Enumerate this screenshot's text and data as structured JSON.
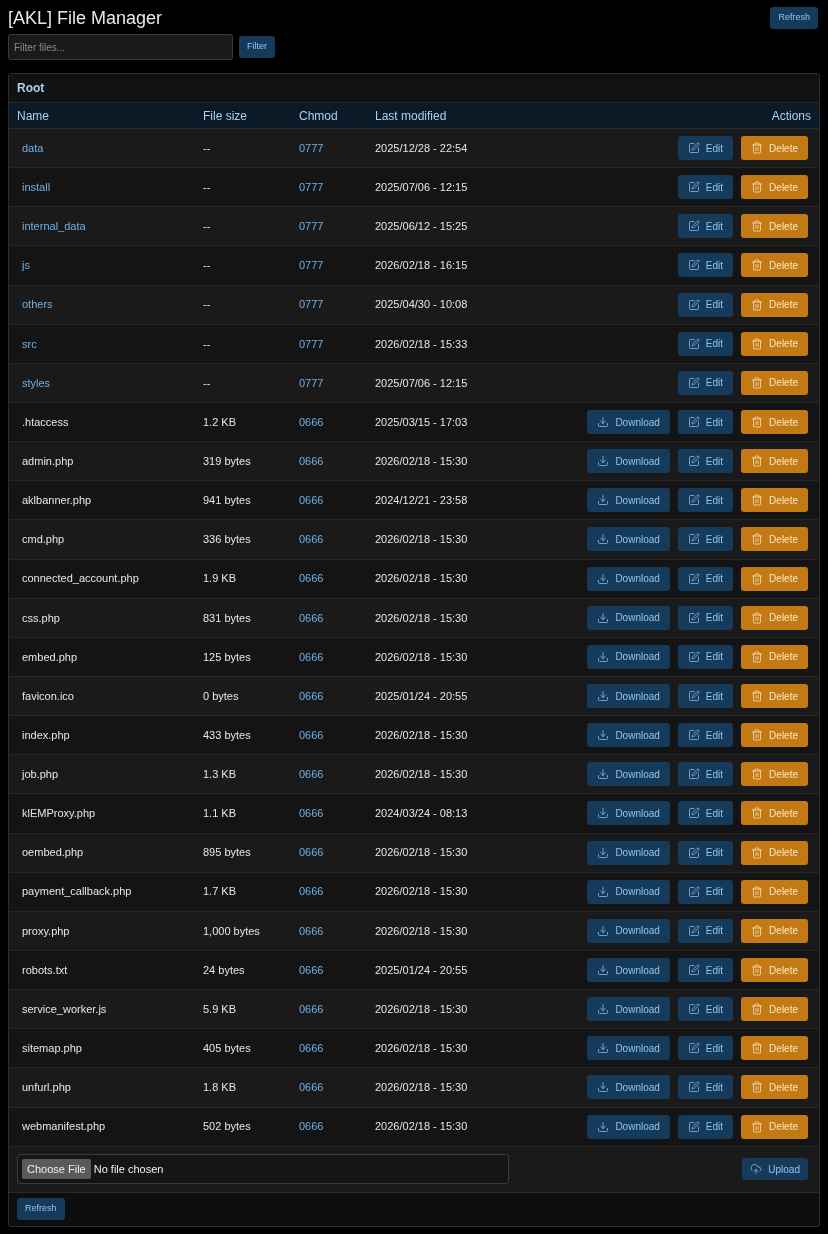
{
  "header": {
    "title": "[AKL] File Manager",
    "refresh_button": "Refresh"
  },
  "filter": {
    "placeholder": "Filter files...",
    "button": "Filter"
  },
  "panel": {
    "title": "Root",
    "columns": [
      "Name",
      "File size",
      "Chmod",
      "Last modified",
      "Actions"
    ],
    "rows": [
      {
        "kind": "folder",
        "name": "data",
        "size": "--",
        "chmod": "0777",
        "modified": "2025/12/28 - 22:54",
        "actions": [
          {
            "kind": "edit",
            "label": "Edit"
          },
          {
            "kind": "delete",
            "label": "Delete"
          }
        ]
      },
      {
        "kind": "folder",
        "name": "install",
        "size": "--",
        "chmod": "0777",
        "modified": "2025/07/06 - 12:15",
        "actions": [
          {
            "kind": "edit",
            "label": "Edit"
          },
          {
            "kind": "delete",
            "label": "Delete"
          }
        ]
      },
      {
        "kind": "folder",
        "name": "internal_data",
        "size": "--",
        "chmod": "0777",
        "modified": "2025/06/12 - 15:25",
        "actions": [
          {
            "kind": "edit",
            "label": "Edit"
          },
          {
            "kind": "delete",
            "label": "Delete"
          }
        ]
      },
      {
        "kind": "folder",
        "name": "js",
        "size": "--",
        "chmod": "0777",
        "modified": "2026/02/18 - 16:15",
        "actions": [
          {
            "kind": "edit",
            "label": "Edit"
          },
          {
            "kind": "delete",
            "label": "Delete"
          }
        ]
      },
      {
        "kind": "folder",
        "name": "others",
        "size": "--",
        "chmod": "0777",
        "modified": "2025/04/30 - 10:08",
        "actions": [
          {
            "kind": "edit",
            "label": "Edit"
          },
          {
            "kind": "delete",
            "label": "Delete"
          }
        ]
      },
      {
        "kind": "folder",
        "name": "src",
        "size": "--",
        "chmod": "0777",
        "modified": "2026/02/18 - 15:33",
        "actions": [
          {
            "kind": "edit",
            "label": "Edit"
          },
          {
            "kind": "delete",
            "label": "Delete"
          }
        ]
      },
      {
        "kind": "folder",
        "name": "styles",
        "size": "--",
        "chmod": "0777",
        "modified": "2025/07/06 - 12:15",
        "actions": [
          {
            "kind": "edit",
            "label": "Edit"
          },
          {
            "kind": "delete",
            "label": "Delete"
          }
        ]
      },
      {
        "kind": "file",
        "name": ".htaccess",
        "size": "1.2 KB",
        "chmod": "0666",
        "modified": "2025/03/15 - 17:03",
        "actions": [
          {
            "kind": "download",
            "label": "Download"
          },
          {
            "kind": "edit",
            "label": "Edit"
          },
          {
            "kind": "delete",
            "label": "Delete"
          }
        ]
      },
      {
        "kind": "file",
        "name": "admin.php",
        "size": "319 bytes",
        "chmod": "0666",
        "modified": "2026/02/18 - 15:30",
        "actions": [
          {
            "kind": "download",
            "label": "Download"
          },
          {
            "kind": "edit",
            "label": "Edit"
          },
          {
            "kind": "delete",
            "label": "Delete"
          }
        ]
      },
      {
        "kind": "file",
        "name": "aklbanner.php",
        "size": "941 bytes",
        "chmod": "0666",
        "modified": "2024/12/21 - 23:58",
        "actions": [
          {
            "kind": "download",
            "label": "Download"
          },
          {
            "kind": "edit",
            "label": "Edit"
          },
          {
            "kind": "delete",
            "label": "Delete"
          }
        ]
      },
      {
        "kind": "file",
        "name": "cmd.php",
        "size": "336 bytes",
        "chmod": "0666",
        "modified": "2026/02/18 - 15:30",
        "actions": [
          {
            "kind": "download",
            "label": "Download"
          },
          {
            "kind": "edit",
            "label": "Edit"
          },
          {
            "kind": "delete",
            "label": "Delete"
          }
        ]
      },
      {
        "kind": "file",
        "name": "connected_account.php",
        "size": "1.9 KB",
        "chmod": "0666",
        "modified": "2026/02/18 - 15:30",
        "actions": [
          {
            "kind": "download",
            "label": "Download"
          },
          {
            "kind": "edit",
            "label": "Edit"
          },
          {
            "kind": "delete",
            "label": "Delete"
          }
        ]
      },
      {
        "kind": "file",
        "name": "css.php",
        "size": "831 bytes",
        "chmod": "0666",
        "modified": "2026/02/18 - 15:30",
        "actions": [
          {
            "kind": "download",
            "label": "Download"
          },
          {
            "kind": "edit",
            "label": "Edit"
          },
          {
            "kind": "delete",
            "label": "Delete"
          }
        ]
      },
      {
        "kind": "file",
        "name": "embed.php",
        "size": "125 bytes",
        "chmod": "0666",
        "modified": "2026/02/18 - 15:30",
        "actions": [
          {
            "kind": "download",
            "label": "Download"
          },
          {
            "kind": "edit",
            "label": "Edit"
          },
          {
            "kind": "delete",
            "label": "Delete"
          }
        ]
      },
      {
        "kind": "file",
        "name": "favicon.ico",
        "size": "0 bytes",
        "chmod": "0666",
        "modified": "2025/01/24 - 20:55",
        "actions": [
          {
            "kind": "download",
            "label": "Download"
          },
          {
            "kind": "edit",
            "label": "Edit"
          },
          {
            "kind": "delete",
            "label": "Delete"
          }
        ]
      },
      {
        "kind": "file",
        "name": "index.php",
        "size": "433 bytes",
        "chmod": "0666",
        "modified": "2026/02/18 - 15:30",
        "actions": [
          {
            "kind": "download",
            "label": "Download"
          },
          {
            "kind": "edit",
            "label": "Edit"
          },
          {
            "kind": "delete",
            "label": "Delete"
          }
        ]
      },
      {
        "kind": "file",
        "name": "job.php",
        "size": "1.3 KB",
        "chmod": "0666",
        "modified": "2026/02/18 - 15:30",
        "actions": [
          {
            "kind": "download",
            "label": "Download"
          },
          {
            "kind": "edit",
            "label": "Edit"
          },
          {
            "kind": "delete",
            "label": "Delete"
          }
        ]
      },
      {
        "kind": "file",
        "name": "klEMProxy.php",
        "size": "1.1 KB",
        "chmod": "0666",
        "modified": "2024/03/24 - 08:13",
        "actions": [
          {
            "kind": "download",
            "label": "Download"
          },
          {
            "kind": "edit",
            "label": "Edit"
          },
          {
            "kind": "delete",
            "label": "Delete"
          }
        ]
      },
      {
        "kind": "file",
        "name": "oembed.php",
        "size": "895 bytes",
        "chmod": "0666",
        "modified": "2026/02/18 - 15:30",
        "actions": [
          {
            "kind": "download",
            "label": "Download"
          },
          {
            "kind": "edit",
            "label": "Edit"
          },
          {
            "kind": "delete",
            "label": "Delete"
          }
        ]
      },
      {
        "kind": "file",
        "name": "payment_callback.php",
        "size": "1.7 KB",
        "chmod": "0666",
        "modified": "2026/02/18 - 15:30",
        "actions": [
          {
            "kind": "download",
            "label": "Download"
          },
          {
            "kind": "edit",
            "label": "Edit"
          },
          {
            "kind": "delete",
            "label": "Delete"
          }
        ]
      },
      {
        "kind": "file",
        "name": "proxy.php",
        "size": "1,000 bytes",
        "chmod": "0666",
        "modified": "2026/02/18 - 15:30",
        "actions": [
          {
            "kind": "download",
            "label": "Download"
          },
          {
            "kind": "edit",
            "label": "Edit"
          },
          {
            "kind": "delete",
            "label": "Delete"
          }
        ]
      },
      {
        "kind": "file",
        "name": "robots.txt",
        "size": "24 bytes",
        "chmod": "0666",
        "modified": "2025/01/24 - 20:55",
        "actions": [
          {
            "kind": "download",
            "label": "Download"
          },
          {
            "kind": "edit",
            "label": "Edit"
          },
          {
            "kind": "delete",
            "label": "Delete"
          }
        ]
      },
      {
        "kind": "file",
        "name": "service_worker.js",
        "size": "5.9 KB",
        "chmod": "0666",
        "modified": "2026/02/18 - 15:30",
        "actions": [
          {
            "kind": "download",
            "label": "Download"
          },
          {
            "kind": "edit",
            "label": "Edit"
          },
          {
            "kind": "delete",
            "label": "Delete"
          }
        ]
      },
      {
        "kind": "file",
        "name": "sitemap.php",
        "size": "405 bytes",
        "chmod": "0666",
        "modified": "2026/02/18 - 15:30",
        "actions": [
          {
            "kind": "download",
            "label": "Download"
          },
          {
            "kind": "edit",
            "label": "Edit"
          },
          {
            "kind": "delete",
            "label": "Delete"
          }
        ]
      },
      {
        "kind": "file",
        "name": "unfurl.php",
        "size": "1.8 KB",
        "chmod": "0666",
        "modified": "2026/02/18 - 15:30",
        "actions": [
          {
            "kind": "download",
            "label": "Download"
          },
          {
            "kind": "edit",
            "label": "Edit"
          },
          {
            "kind": "delete",
            "label": "Delete"
          }
        ]
      },
      {
        "kind": "file",
        "name": "webmanifest.php",
        "size": "502 bytes",
        "chmod": "0666",
        "modified": "2026/02/18 - 15:30",
        "actions": [
          {
            "kind": "download",
            "label": "Download"
          },
          {
            "kind": "edit",
            "label": "Edit"
          },
          {
            "kind": "delete",
            "label": "Delete"
          }
        ]
      }
    ],
    "upload": {
      "choose_button": "Choose File",
      "status": "No file chosen",
      "upload_button": "Upload"
    },
    "footer_refresh": "Refresh"
  }
}
